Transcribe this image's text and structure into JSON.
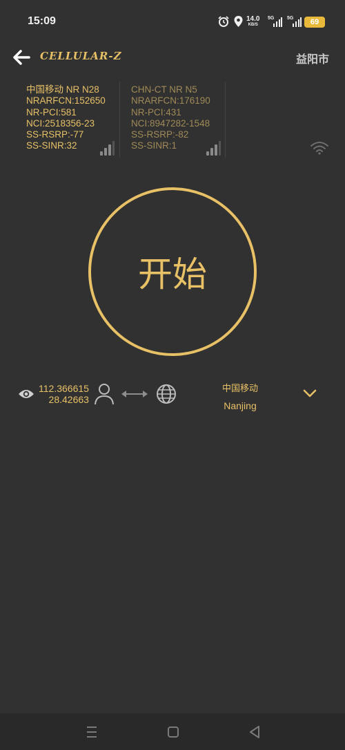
{
  "status_bar": {
    "time": "15:09",
    "net_speed_value": "14.0",
    "net_speed_unit": "KB/S",
    "sim1_label": "5G",
    "sim2_label": "5G",
    "battery": "69",
    "icons": [
      "alarm-icon",
      "location-icon",
      "signal-bars-icon",
      "signal-bars-icon"
    ]
  },
  "header": {
    "app_name": "CELLULAR-Z",
    "city": "益阳市"
  },
  "cells": [
    {
      "lines": [
        "中国移动 NR N28",
        "NRARFCN:152650",
        "NR-PCI:581",
        "NCI:2518356-23",
        "SS-RSRP:-77",
        "SS-SINR:32"
      ]
    },
    {
      "lines": [
        "CHN-CT NR N5",
        "NRARFCN:176190",
        "NR-PCI:431",
        "NCI:8947282-1548",
        "SS-RSRP:-82",
        "SS-SINR:1"
      ]
    }
  ],
  "start_button": {
    "label": "开始"
  },
  "info": {
    "longitude": "112.366615",
    "latitude": "28.42663",
    "operator": "中国移动",
    "city": "Nanjing"
  },
  "colors": {
    "accent": "#e8c167",
    "background": "#313131",
    "muted_accent": "#a08a57",
    "battery": "#e9b93c"
  }
}
